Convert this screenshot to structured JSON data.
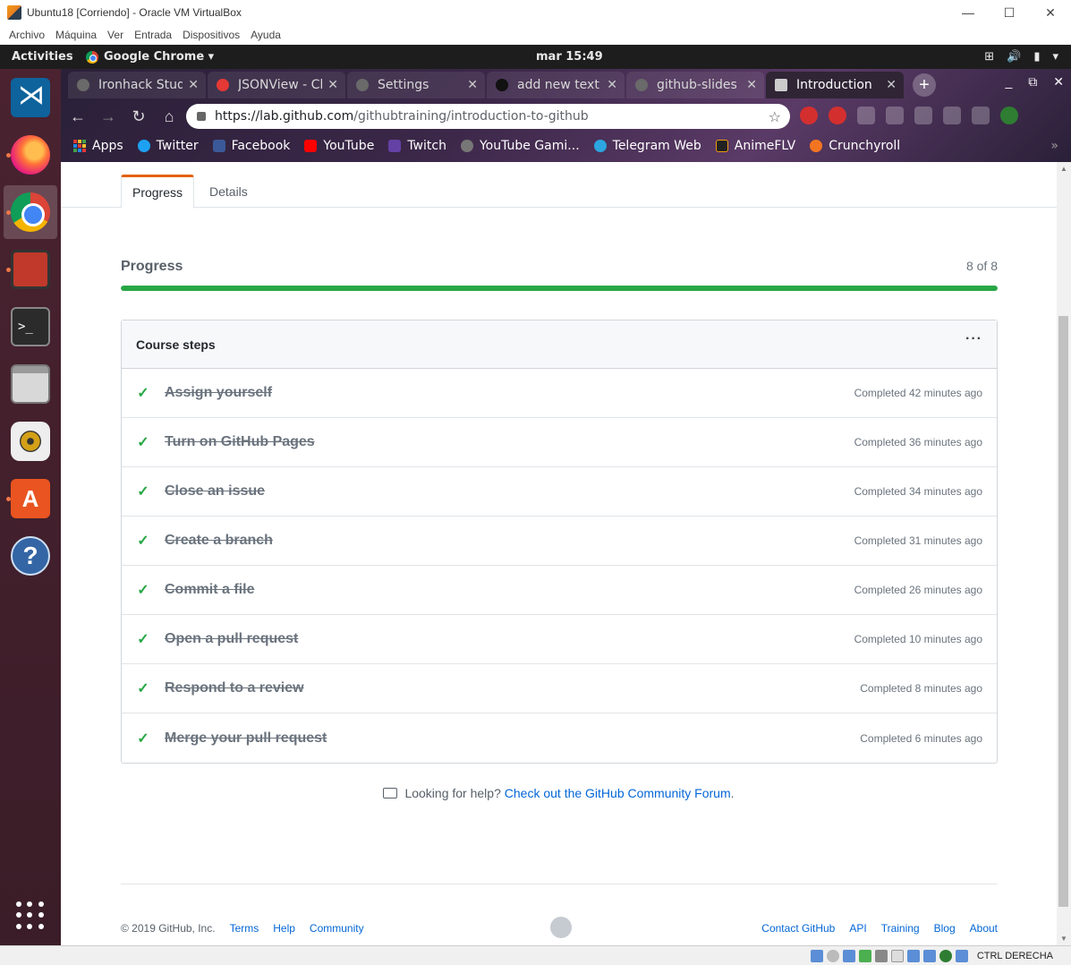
{
  "vbox": {
    "title": "Ubuntu18 [Corriendo] - Oracle VM VirtualBox",
    "menu": [
      "Archivo",
      "Máquina",
      "Ver",
      "Entrada",
      "Dispositivos",
      "Ayuda"
    ],
    "controls": {
      "minimize": "—",
      "maximize": "☐",
      "close": "✕"
    },
    "host_key": "CTRL DERECHA"
  },
  "topbar": {
    "activities": "Activities",
    "app_menu": "Google Chrome ▾",
    "clock": "mar 15:49",
    "sys_icons": [
      "network-icon",
      "volume-icon",
      "battery-icon",
      "menu-arrow-icon"
    ],
    "sys_glyphs": [
      "⊞",
      "🔊",
      "▮",
      "▾"
    ]
  },
  "dock": {
    "items": [
      {
        "name": "vscode",
        "active": false,
        "running": false
      },
      {
        "name": "firefox",
        "active": false,
        "running": true
      },
      {
        "name": "chrome",
        "active": true,
        "running": true
      },
      {
        "name": "remmina",
        "active": false,
        "running": true
      },
      {
        "name": "terminal",
        "active": false,
        "running": false
      },
      {
        "name": "files",
        "active": false,
        "running": false
      },
      {
        "name": "rhythmbox",
        "active": false,
        "running": false
      },
      {
        "name": "software-center",
        "active": false,
        "running": true
      },
      {
        "name": "help",
        "active": false,
        "running": false
      }
    ],
    "terminal_glyph": ">_",
    "store_glyph": "A",
    "help_glyph": "?"
  },
  "chrome": {
    "tabs": [
      {
        "title": "Ironhack Student Portal",
        "active": false
      },
      {
        "title": "JSONView - Chrome",
        "active": false
      },
      {
        "title": "Settings",
        "active": false
      },
      {
        "title": "add new text",
        "active": false
      },
      {
        "title": "github-slides",
        "active": false
      },
      {
        "title": "Introduction",
        "active": true
      }
    ],
    "tab_close": "✕",
    "new_tab": "+",
    "window_controls": [
      "_",
      "⧉",
      "✕"
    ],
    "nav": {
      "back": "←",
      "forward": "→",
      "reload": "↻",
      "home": "⌂"
    },
    "url_host": "https://lab.github.com",
    "url_path": "/githubtraining/introduction-to-github",
    "star": "☆",
    "bookmarks": [
      {
        "label": "Apps",
        "color": "#e53935"
      },
      {
        "label": "Twitter",
        "color": "#1da1f2"
      },
      {
        "label": "Facebook",
        "color": "#3b5998"
      },
      {
        "label": "YouTube",
        "color": "#ff0000"
      },
      {
        "label": "Twitch",
        "color": "#6441a5"
      },
      {
        "label": "YouTube Gami...",
        "color": "#555555"
      },
      {
        "label": "Telegram Web",
        "color": "#2ca5e0"
      },
      {
        "label": "AnimeFLV",
        "color": "#222222"
      },
      {
        "label": "Crunchyroll",
        "color": "#f47521"
      }
    ],
    "bookmarks_more": "»"
  },
  "page": {
    "tabs": [
      {
        "label": "Progress",
        "selected": true
      },
      {
        "label": "Details",
        "selected": false
      }
    ],
    "progress": {
      "title": "Progress",
      "count_text": "8 of 8",
      "fraction": 1.0,
      "color": "#28a745"
    },
    "course_steps": {
      "title": "Course steps",
      "menu_glyph": "···",
      "check_glyph": "✓",
      "steps": [
        {
          "label": "Assign yourself",
          "time": "Completed 42 minutes ago"
        },
        {
          "label": "Turn on GitHub Pages",
          "time": "Completed 36 minutes ago"
        },
        {
          "label": "Close an issue",
          "time": "Completed 34 minutes ago"
        },
        {
          "label": "Create a branch",
          "time": "Completed 31 minutes ago"
        },
        {
          "label": "Commit a file",
          "time": "Completed 26 minutes ago"
        },
        {
          "label": "Open a pull request",
          "time": "Completed 10 minutes ago"
        },
        {
          "label": "Respond to a review",
          "time": "Completed 8 minutes ago"
        },
        {
          "label": "Merge your pull request",
          "time": "Completed 6 minutes ago"
        }
      ]
    },
    "help": {
      "prefix": "Looking for help?",
      "link": "Check out the GitHub Community Forum",
      "suffix": "."
    },
    "footer": {
      "copyright": "© 2019 GitHub, Inc.",
      "left_links": [
        "Terms",
        "Help",
        "Community"
      ],
      "right_links": [
        "Contact GitHub",
        "API",
        "Training",
        "Blog",
        "About"
      ]
    }
  },
  "colors": {
    "link": "#0366d6",
    "success": "#28a745",
    "tab_accent": "#e36209"
  }
}
